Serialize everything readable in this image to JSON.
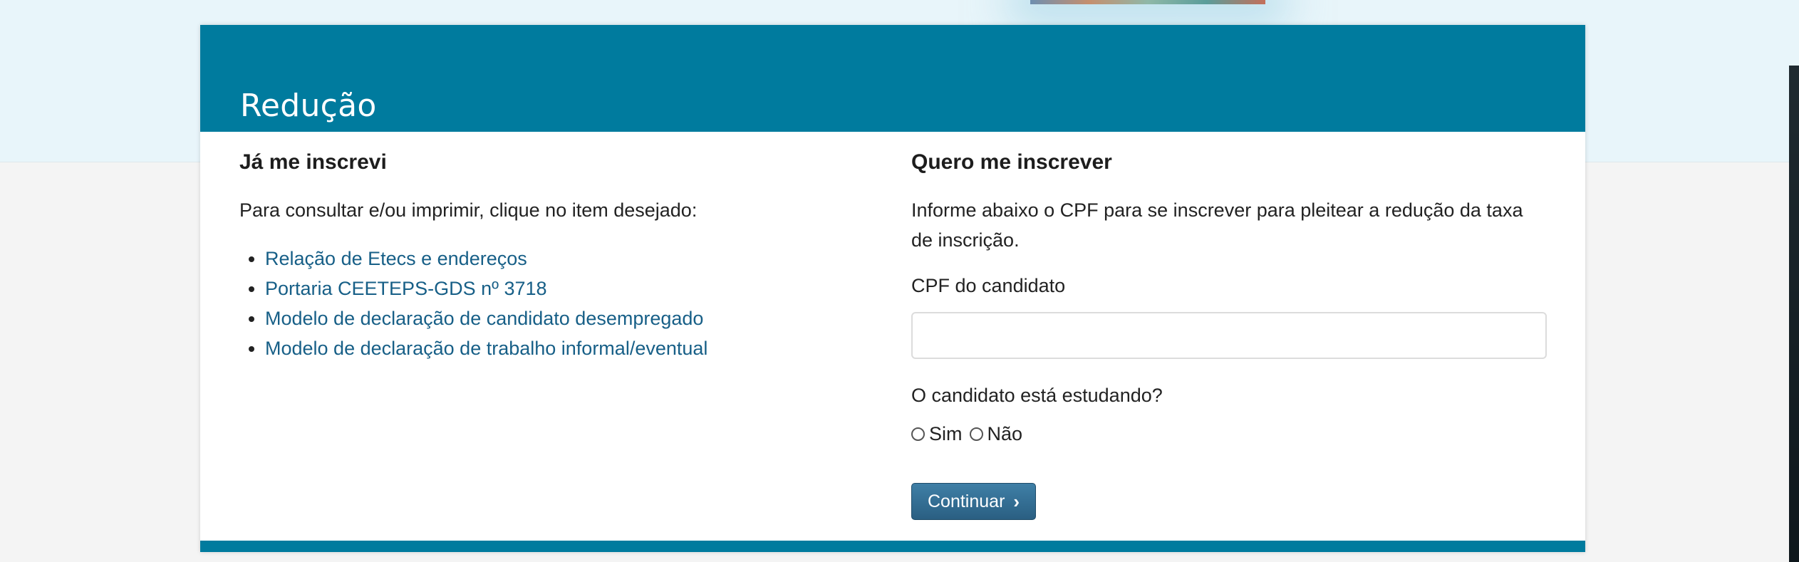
{
  "page": {
    "title": "Redução"
  },
  "left": {
    "heading": "Já me inscrevi",
    "intro": "Para consultar e/ou imprimir, clique no item desejado:",
    "links": [
      "Relação de Etecs e endereços",
      "Portaria CEETEPS-GDS nº 3718",
      "Modelo de declaração de candidato desempregado",
      "Modelo de declaração de trabalho informal/eventual"
    ]
  },
  "right": {
    "heading": "Quero me inscrever",
    "intro": "Informe abaixo o CPF para se inscrever para pleitear a redução da taxa de inscrição.",
    "cpf_label": "CPF do candidato",
    "cpf_value": "",
    "question": "O candidato está estudando?",
    "options": [
      "Sim",
      "Não"
    ],
    "button_label": "Continuar"
  },
  "colors": {
    "header": "#007b9e",
    "link": "#175f87",
    "button": "#2f6a8f"
  },
  "icons": {
    "button_icon": "chevron-right-icon"
  }
}
